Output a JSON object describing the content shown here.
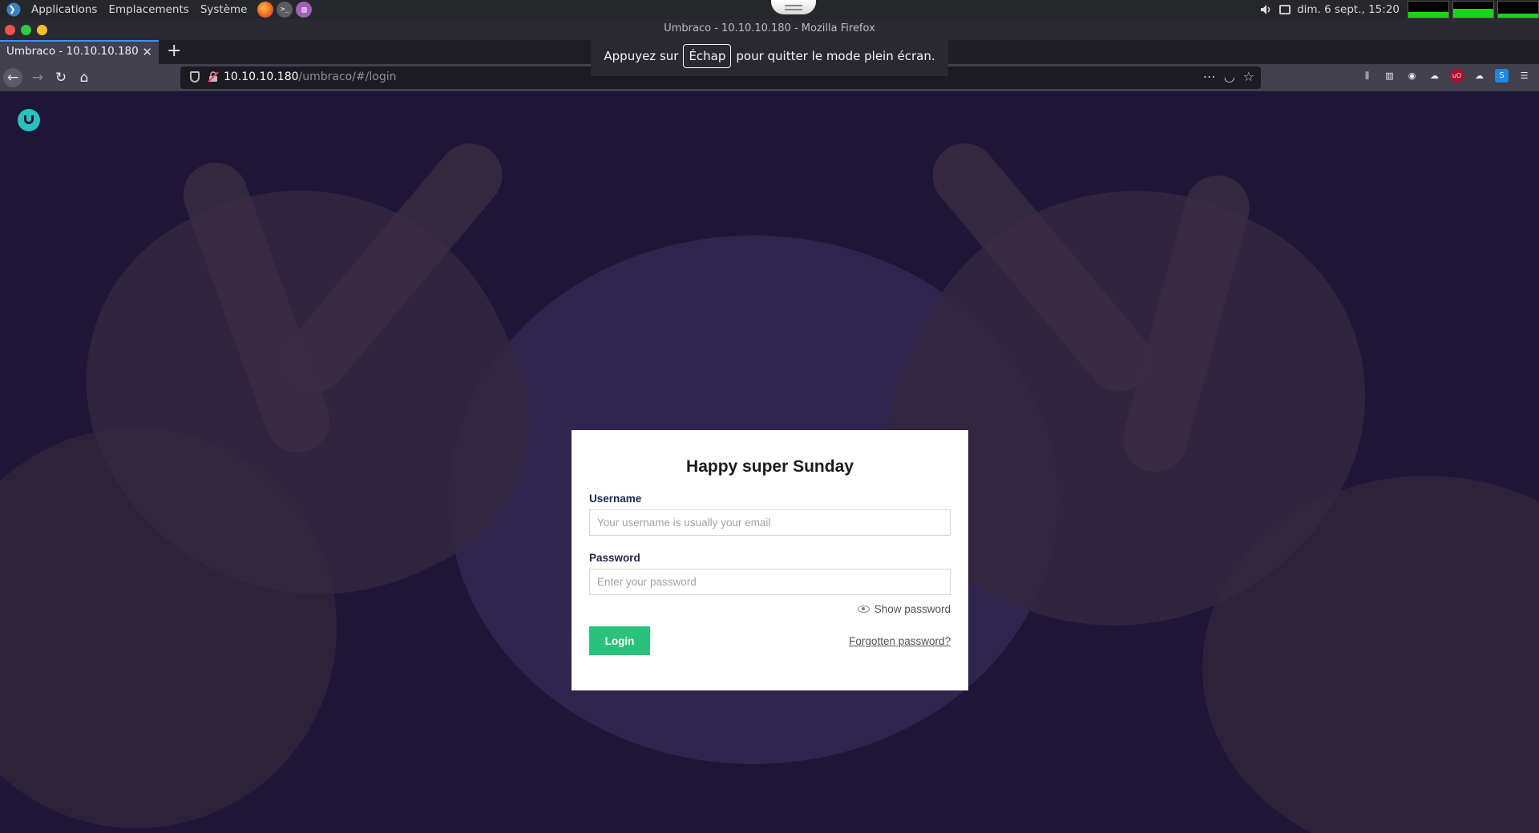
{
  "system_panel": {
    "menu": [
      "Applications",
      "Emplacements",
      "Système"
    ],
    "clock": "dim.  6 sept., 15:20",
    "monitors": [
      0.35,
      0.55,
      0.25
    ]
  },
  "browser": {
    "window_title": "Umbraco - 10.10.10.180 - Mozilla Firefox",
    "tab_title": "Umbraco - 10.10.10.180",
    "url_host": "10.10.10.180",
    "url_path": "/umbraco/#/login",
    "fullscreen_notice": {
      "before": "Appuyez sur",
      "key": "Échap",
      "after": "pour quitter le mode plein écran."
    }
  },
  "login": {
    "greeting": "Happy super Sunday",
    "username_label": "Username",
    "username_placeholder": "Your username is usually your email",
    "password_label": "Password",
    "password_placeholder": "Enter your password",
    "show_password": "Show password",
    "login_button": "Login",
    "forgot_password": "Forgotten password?"
  },
  "colors": {
    "accent_green": "#2bc37c",
    "umbraco_teal": "#27c1bf",
    "background": "#1e1636"
  }
}
